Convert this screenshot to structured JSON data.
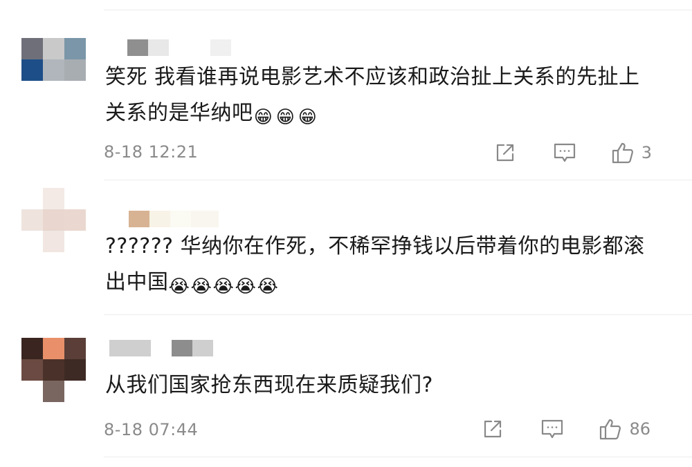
{
  "comments": [
    {
      "text": "笑死 我看谁再说电影艺术不应该和政治扯上关系的先扯上关系的是华纳吧",
      "emojis": [
        "😁",
        "😁",
        "😁"
      ],
      "timestamp": "8-18 12:21",
      "like_count": "3",
      "avatar_colors": [
        "#6f6f7a",
        "#c9c9c9",
        "#7a96a8",
        "#1e4e87",
        "#b0b6bb",
        "#a8adb2",
        "#ffffff",
        "#ffffff",
        "#ffffff"
      ]
    },
    {
      "text": "?????? 华纳你在作死，不稀罕挣钱以后带着你的电影都滚出中国",
      "emojis": [
        "😭",
        "😭",
        "😭",
        "😭",
        "😭"
      ],
      "timestamp": "",
      "like_count": "",
      "avatar_colors": [
        "#ffffff",
        "#f3e9e5",
        "#ffffff",
        "#efe3de",
        "#e8d6cf",
        "#ead8d0",
        "#ffffff",
        "#f1e6e1",
        "#ffffff"
      ]
    },
    {
      "text": "从我们国家抢东西现在来质疑我们?",
      "emojis": [],
      "timestamp": "8-18 07:44",
      "like_count": "86",
      "avatar_colors": [
        "#3a2520",
        "#e9906a",
        "#5a3e37",
        "#6a4a42",
        "#4a3129",
        "#3e2a24",
        "#ffffff",
        "#7a6660",
        "#ffffff"
      ]
    }
  ],
  "icons": {
    "share": "share-icon",
    "reply": "comment-icon",
    "like": "thumbs-up-icon"
  }
}
